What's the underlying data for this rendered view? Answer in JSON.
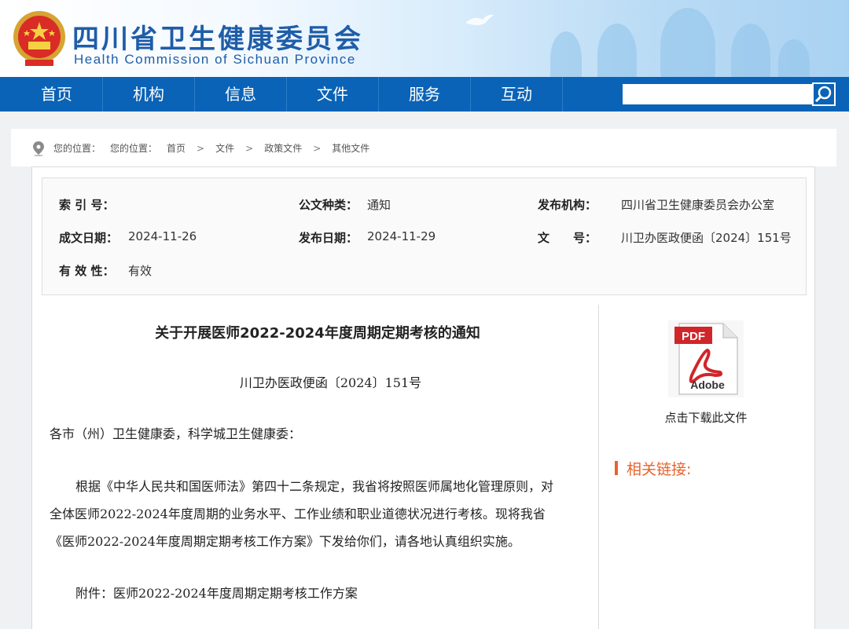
{
  "header": {
    "title": "四川省卫生健康委员会",
    "subtitle": "Health Commission of Sichuan Province",
    "emblem_icon": "national-emblem-icon"
  },
  "nav": {
    "items": [
      "首页",
      "机构",
      "信息",
      "文件",
      "服务",
      "互动"
    ],
    "search_placeholder": "",
    "search_icon": "search-icon"
  },
  "breadcrumb": {
    "prefix": "您的位置：",
    "items": [
      "您的位置：",
      "首页",
      "文件",
      "政策文件",
      "其他文件"
    ],
    "separator": ">"
  },
  "meta": {
    "index_label": "索 引 号：",
    "index_value": "",
    "type_label": "公文种类：",
    "type_value": "通知",
    "org_label": "发布机构：",
    "org_value": "四川省卫生健康委员会办公室",
    "created_label": "成文日期：",
    "created_value": "2024-11-26",
    "published_label": "发布日期：",
    "published_value": "2024-11-29",
    "docno_label": "文　　号：",
    "docno_value": "川卫办医政便函〔2024〕151号",
    "valid_label": "有 效 性：",
    "valid_value": "有效"
  },
  "document": {
    "title": "关于开展医师2022-2024年度周期定期考核的通知",
    "number": "川卫办医政便函〔2024〕151号",
    "salutation": "各市（州）卫生健康委，科学城卫生健康委：",
    "body_line1": "根据《中华人民共和国医师法》第四十二条规定，我省将按照医师属地化管理原则，对",
    "body_line2": "全体医师2022-2024年度周期的业务水平、工作业绩和职业道德状况进行考核。现将我省",
    "body_line3": "《医师2022-2024年度周期定期考核工作方案》下发给你们，请各地认真组织实施。",
    "attachment": "附件：医师2022-2024年度周期定期考核工作方案"
  },
  "sidebar": {
    "pdf_badge": "PDF",
    "pdf_brand": "Adobe",
    "download_label": "点击下载此文件",
    "related_title": "相关链接:"
  },
  "colors": {
    "nav_bg": "#0a63b6",
    "title_blue": "#1f5da8",
    "accent_orange": "#e8632b"
  }
}
